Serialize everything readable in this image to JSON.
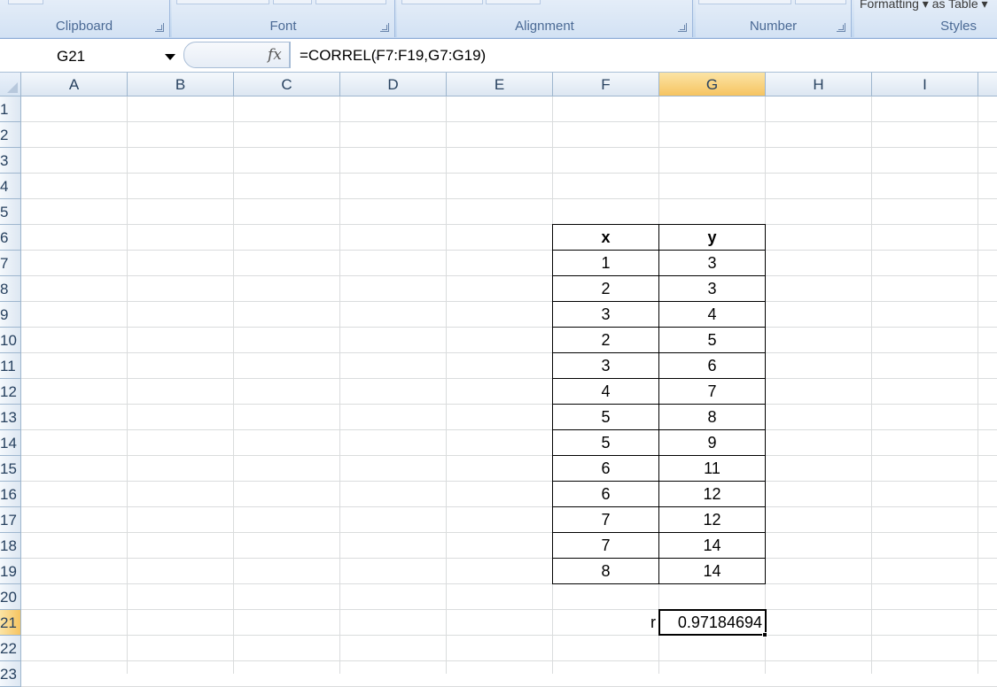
{
  "ribbon": {
    "groups": [
      {
        "label": "Clipboard"
      },
      {
        "label": "Font"
      },
      {
        "label": "Alignment"
      },
      {
        "label": "Number"
      },
      {
        "label": "Styles"
      }
    ],
    "styles_cut_text": "Formatting ▾ as Table ▾"
  },
  "formula_bar": {
    "name_box": "G21",
    "fx_symbol": "fx",
    "formula": "=CORREL(F7:F19,G7:G19)"
  },
  "columns": [
    "A",
    "B",
    "C",
    "D",
    "E",
    "F",
    "G",
    "H",
    "I"
  ],
  "active_column": "G",
  "rows": [
    "1",
    "2",
    "3",
    "4",
    "5",
    "6",
    "7",
    "8",
    "9",
    "10",
    "11",
    "12",
    "13",
    "14",
    "15",
    "16",
    "17",
    "18",
    "19",
    "20",
    "21",
    "22",
    "23"
  ],
  "active_row": "21",
  "table": {
    "headers": [
      "x",
      "y"
    ],
    "rows": [
      [
        "1",
        "3"
      ],
      [
        "2",
        "3"
      ],
      [
        "3",
        "4"
      ],
      [
        "2",
        "5"
      ],
      [
        "3",
        "6"
      ],
      [
        "4",
        "7"
      ],
      [
        "5",
        "8"
      ],
      [
        "5",
        "9"
      ],
      [
        "6",
        "11"
      ],
      [
        "6",
        "12"
      ],
      [
        "7",
        "12"
      ],
      [
        "7",
        "14"
      ],
      [
        "8",
        "14"
      ]
    ]
  },
  "result": {
    "label": "r",
    "value": "0.97184694"
  }
}
